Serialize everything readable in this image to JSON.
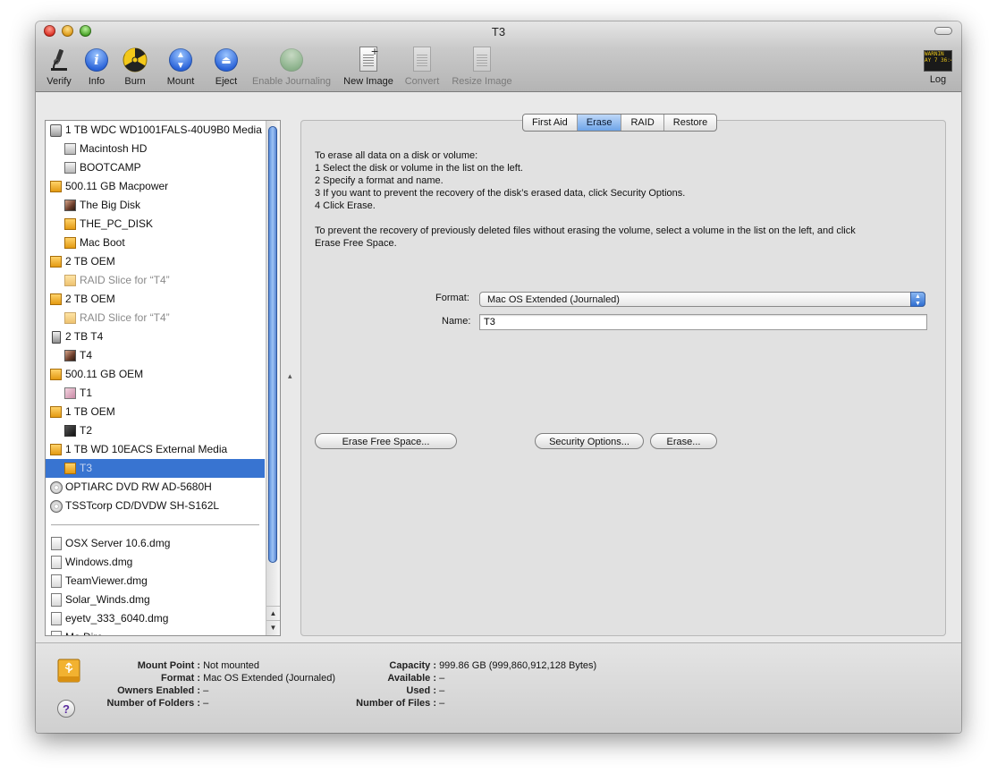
{
  "window": {
    "title": "T3"
  },
  "toolbar": {
    "items": [
      {
        "label": "Verify",
        "icon": "microscope-icon",
        "enabled": true
      },
      {
        "label": "Info",
        "icon": "info-icon",
        "enabled": true
      },
      {
        "label": "Burn",
        "icon": "burn-icon",
        "enabled": true
      },
      {
        "label": "Mount",
        "icon": "mount-icon",
        "enabled": true
      },
      {
        "label": "Eject",
        "icon": "eject-icon",
        "enabled": true
      },
      {
        "label": "Enable Journaling",
        "icon": "journaling-icon",
        "enabled": false
      },
      {
        "label": "New Image",
        "icon": "new-image-icon",
        "enabled": true
      },
      {
        "label": "Convert",
        "icon": "convert-icon",
        "enabled": false
      },
      {
        "label": "Resize Image",
        "icon": "resize-image-icon",
        "enabled": false
      }
    ],
    "log_label": "Log",
    "log_icon_text": "WARNIN\nAY 7 36:4"
  },
  "sidebar": {
    "items": [
      {
        "label": "1 TB WDC WD1001FALS-40U9B0 Media",
        "icon": "internal-disk-icon",
        "level": 0
      },
      {
        "label": "Macintosh HD",
        "icon": "volume-icon",
        "level": 1
      },
      {
        "label": "BOOTCAMP",
        "icon": "volume-icon",
        "level": 1
      },
      {
        "label": "500.11 GB Macpower",
        "icon": "external-disk-icon",
        "level": 0
      },
      {
        "label": "The Big Disk",
        "icon": "photo-volume-icon",
        "level": 1
      },
      {
        "label": "THE_PC_DISK",
        "icon": "external-disk-icon",
        "level": 1
      },
      {
        "label": "Mac Boot",
        "icon": "external-disk-icon",
        "level": 1
      },
      {
        "label": "2 TB OEM",
        "icon": "external-disk-icon",
        "level": 0
      },
      {
        "label": "RAID Slice for “T4”",
        "icon": "external-disk-icon",
        "level": 1,
        "dim": true
      },
      {
        "label": "2 TB OEM",
        "icon": "external-disk-icon",
        "level": 0
      },
      {
        "label": "RAID Slice for “T4”",
        "icon": "external-disk-icon",
        "level": 1,
        "dim": true
      },
      {
        "label": "2 TB T4",
        "icon": "usb-disk-icon",
        "level": 0
      },
      {
        "label": "T4",
        "icon": "photo-volume-icon",
        "level": 1
      },
      {
        "label": "500.11 GB OEM",
        "icon": "external-disk-icon",
        "level": 0
      },
      {
        "label": "T1",
        "icon": "photo-volume-icon",
        "level": 1
      },
      {
        "label": "1 TB OEM",
        "icon": "external-disk-icon",
        "level": 0
      },
      {
        "label": "T2",
        "icon": "photo-volume-icon",
        "level": 1
      },
      {
        "label": "1 TB WD 10EACS External Media",
        "icon": "external-disk-icon",
        "level": 0
      },
      {
        "label": "T3",
        "icon": "external-disk-icon",
        "level": 1,
        "selected": true,
        "dim": true
      },
      {
        "label": "OPTIARC DVD RW AD-5680H",
        "icon": "optical-drive-icon",
        "level": 0
      },
      {
        "label": "TSSTcorp CD/DVDW SH-S162L",
        "icon": "optical-drive-icon",
        "level": 0
      }
    ],
    "images": [
      {
        "label": "OSX Server 10.6.dmg",
        "icon": "disk-image-icon"
      },
      {
        "label": "Windows.dmg",
        "icon": "disk-image-icon"
      },
      {
        "label": "TeamViewer.dmg",
        "icon": "disk-image-icon"
      },
      {
        "label": "Solar_Winds.dmg",
        "icon": "disk-image-icon"
      },
      {
        "label": "eyetv_333_6040.dmg",
        "icon": "disk-image-icon"
      },
      {
        "label": "Ma Dire...",
        "icon": "disk-image-icon"
      }
    ]
  },
  "tabs": [
    {
      "label": "First Aid",
      "active": false
    },
    {
      "label": "Erase",
      "active": true
    },
    {
      "label": "RAID",
      "active": false
    },
    {
      "label": "Restore",
      "active": false
    }
  ],
  "erase": {
    "instructions": [
      "To erase all data on a disk or volume:",
      "1  Select the disk or volume in the list on the left.",
      "2  Specify a format and name.",
      "3  If you want to prevent the recovery of the disk’s erased data, click Security Options.",
      "4  Click Erase."
    ],
    "free_space_note_line1": "To prevent the recovery of previously deleted files without erasing the volume, select a volume in the list on the left, and click",
    "free_space_note_line2": "Erase Free Space.",
    "format_label": "Format:",
    "format_value": "Mac OS Extended (Journaled)",
    "name_label": "Name:",
    "name_value": "T3",
    "erase_free_space_button": "Erase Free Space...",
    "security_options_button": "Security Options...",
    "erase_button": "Erase..."
  },
  "info_panel": {
    "left": [
      {
        "key": "Mount Point :",
        "value": "Not mounted"
      },
      {
        "key": "Format :",
        "value": "Mac OS Extended (Journaled)"
      },
      {
        "key": "Owners Enabled :",
        "value": "–"
      },
      {
        "key": "Number of Folders :",
        "value": "–"
      }
    ],
    "right": [
      {
        "key": "Capacity :",
        "value": "999.86 GB (999,860,912,128 Bytes)"
      },
      {
        "key": "Available :",
        "value": "–"
      },
      {
        "key": "Used :",
        "value": "–"
      },
      {
        "key": "Number of Files :",
        "value": "–"
      }
    ],
    "help_label": "?"
  }
}
